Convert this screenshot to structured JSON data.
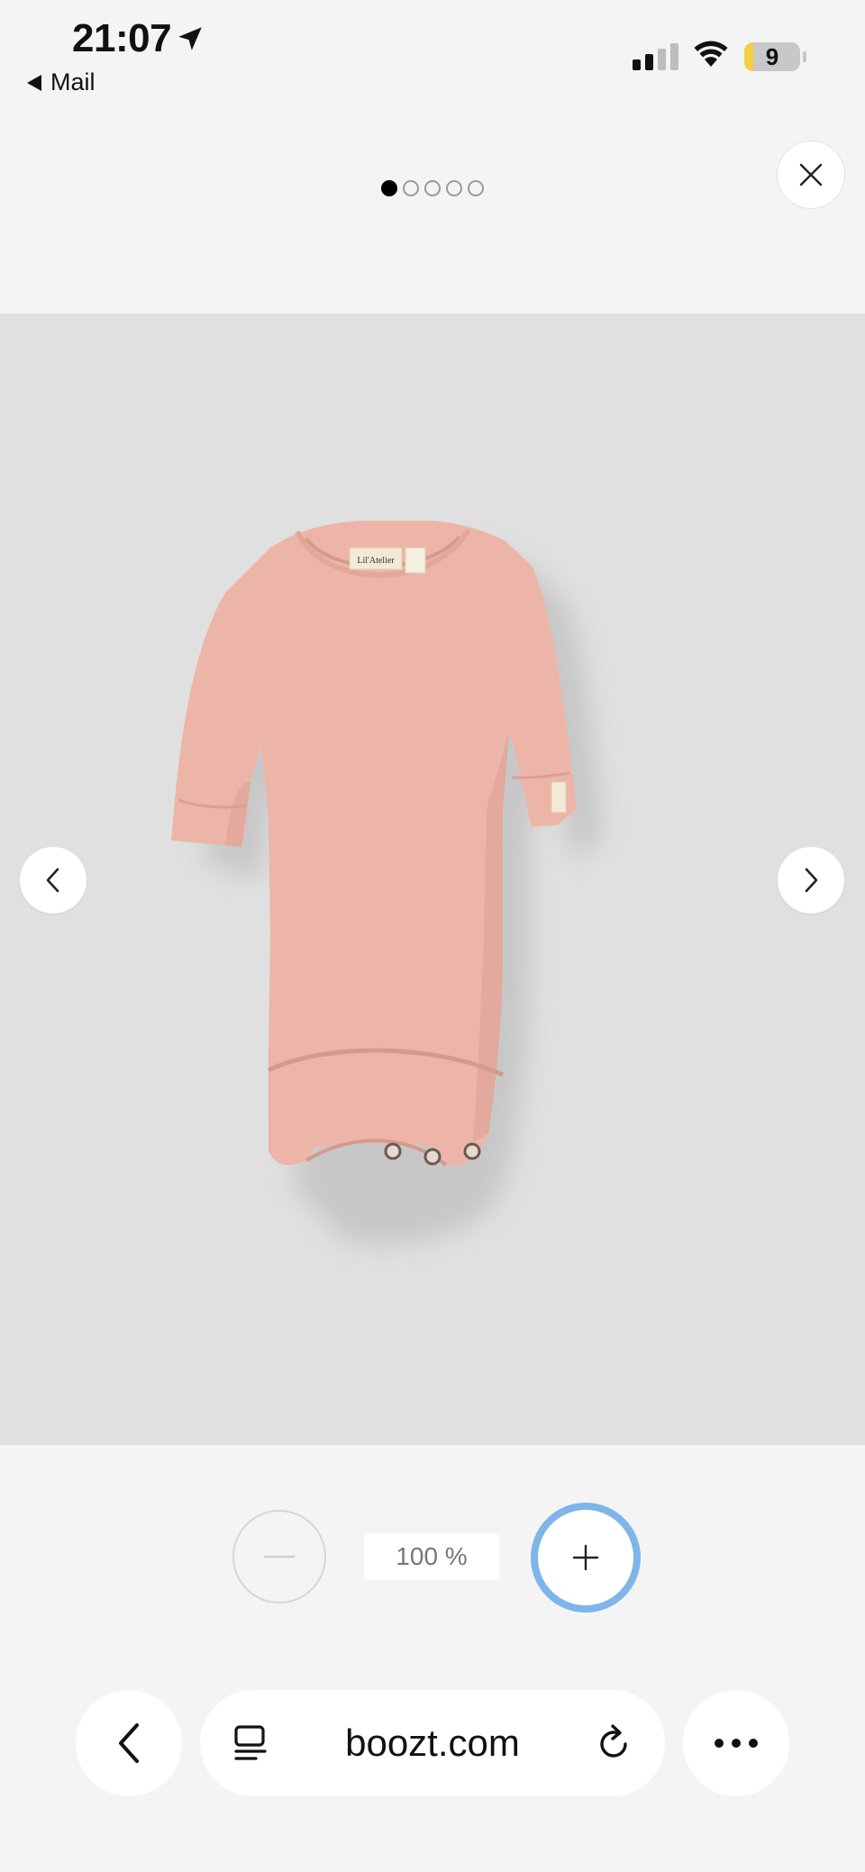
{
  "status_bar": {
    "time": "21:07",
    "back_app": "Mail",
    "battery_level": "9",
    "signal_bars": 2,
    "icons": [
      "location-arrow-icon",
      "signal-icon",
      "wifi-icon",
      "battery-icon"
    ]
  },
  "gallery": {
    "image_count": 5,
    "current_index": 0,
    "label_text": "Lil'Atelier",
    "background_color": "#e0e0e0",
    "product_color": "#edb5a8"
  },
  "zoom": {
    "value": "100 %"
  },
  "browser": {
    "url": "boozt.com"
  },
  "colors": {
    "accent": "#7fb5e8",
    "page_bg": "#f4f4f4"
  }
}
